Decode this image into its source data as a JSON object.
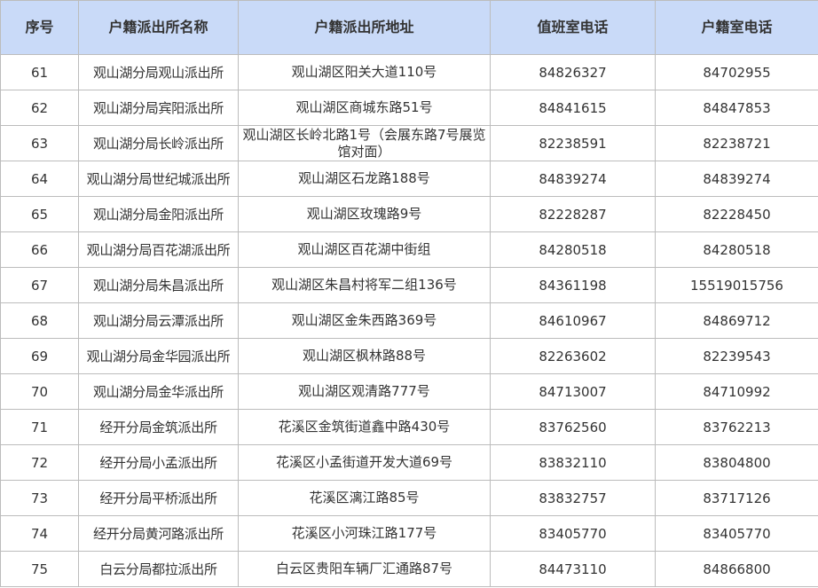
{
  "table": {
    "headers": [
      "序号",
      "户籍派出所名称",
      "户籍派出所地址",
      "值班室电话",
      "户籍室电话"
    ],
    "rows": [
      {
        "no": "61",
        "name": "观山湖分局观山派出所",
        "address": "观山湖区阳关大道110号",
        "duty_phone": "84826327",
        "hukou_phone": "84702955"
      },
      {
        "no": "62",
        "name": "观山湖分局宾阳派出所",
        "address": "观山湖区商城东路51号",
        "duty_phone": "84841615",
        "hukou_phone": "84847853"
      },
      {
        "no": "63",
        "name": "观山湖分局长岭派出所",
        "address": "观山湖区长岭北路1号（会展东路7号展览馆对面）",
        "duty_phone": "82238591",
        "hukou_phone": "82238721"
      },
      {
        "no": "64",
        "name": "观山湖分局世纪城派出所",
        "address": "观山湖区石龙路188号",
        "duty_phone": "84839274",
        "hukou_phone": "84839274"
      },
      {
        "no": "65",
        "name": "观山湖分局金阳派出所",
        "address": "观山湖区玫瑰路9号",
        "duty_phone": "82228287",
        "hukou_phone": "82228450"
      },
      {
        "no": "66",
        "name": "观山湖分局百花湖派出所",
        "address": "观山湖区百花湖中街组",
        "duty_phone": "84280518",
        "hukou_phone": "84280518"
      },
      {
        "no": "67",
        "name": "观山湖分局朱昌派出所",
        "address": "观山湖区朱昌村将军二组136号",
        "duty_phone": "84361198",
        "hukou_phone": "15519015756"
      },
      {
        "no": "68",
        "name": "观山湖分局云潭派出所",
        "address": "观山湖区金朱西路369号",
        "duty_phone": "84610967",
        "hukou_phone": "84869712"
      },
      {
        "no": "69",
        "name": "观山湖分局金华园派出所",
        "address": "观山湖区枫林路88号",
        "duty_phone": "82263602",
        "hukou_phone": "82239543"
      },
      {
        "no": "70",
        "name": "观山湖分局金华派出所",
        "address": "观山湖区观清路777号",
        "duty_phone": "84713007",
        "hukou_phone": "84710992"
      },
      {
        "no": "71",
        "name": "经开分局金筑派出所",
        "address": "花溪区金筑街道鑫中路430号",
        "duty_phone": "83762560",
        "hukou_phone": "83762213"
      },
      {
        "no": "72",
        "name": "经开分局小孟派出所",
        "address": "花溪区小孟街道开发大道69号",
        "duty_phone": "83832110",
        "hukou_phone": "83804800"
      },
      {
        "no": "73",
        "name": "经开分局平桥派出所",
        "address": "花溪区漓江路85号",
        "duty_phone": "83832757",
        "hukou_phone": "83717126"
      },
      {
        "no": "74",
        "name": "经开分局黄河路派出所",
        "address": "花溪区小河珠江路177号",
        "duty_phone": "83405770",
        "hukou_phone": "83405770"
      },
      {
        "no": "75",
        "name": "白云分局都拉派出所",
        "address": "白云区贵阳车辆厂汇通路87号",
        "duty_phone": "84473110",
        "hukou_phone": "84866800"
      }
    ]
  }
}
